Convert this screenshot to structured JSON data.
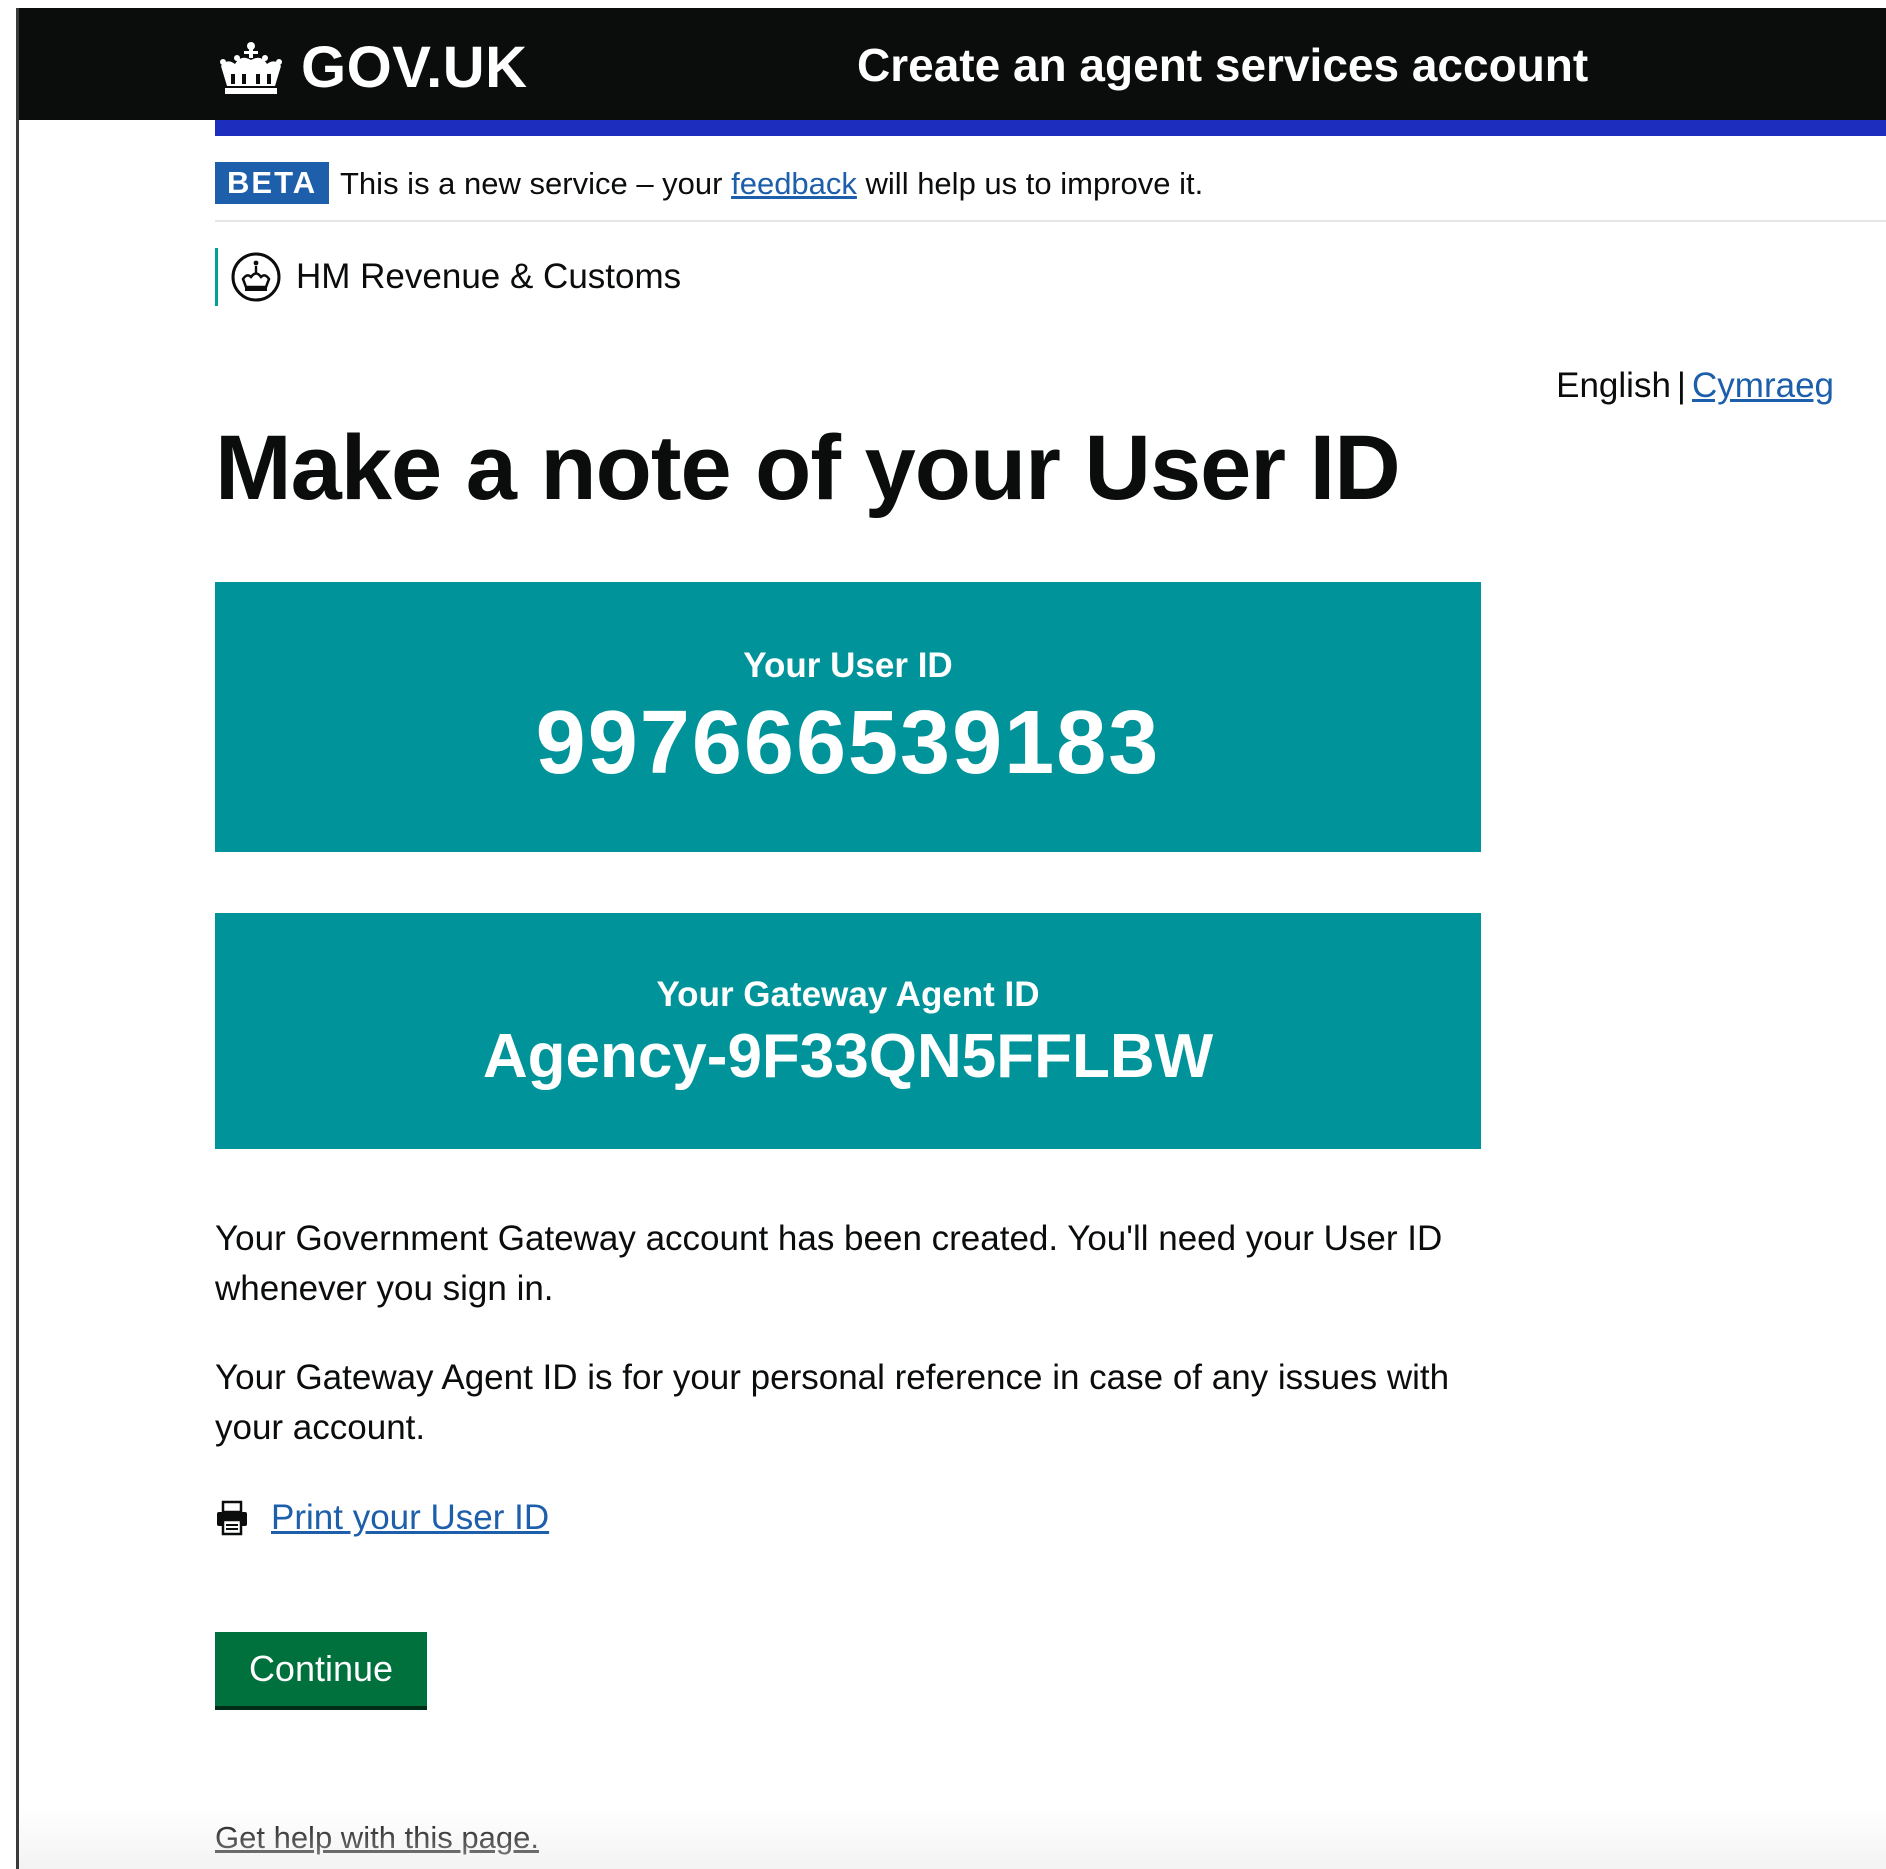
{
  "header": {
    "logo_text": "GOV.UK",
    "service_name": "Create an agent services account"
  },
  "phase_banner": {
    "tag": "BETA",
    "text_before": "This is a new service – your ",
    "link": "feedback",
    "text_after": " will help us to improve it."
  },
  "department": {
    "name": "HM Revenue & Customs"
  },
  "language": {
    "current": "English",
    "separator": "|",
    "alternate": "Cymraeg"
  },
  "main": {
    "title": "Make a note of your User ID",
    "user_id_panel": {
      "label": "Your User ID",
      "value": "997666539183"
    },
    "agent_id_panel": {
      "label": "Your Gateway Agent ID",
      "value": "Agency-9F33QN5FFLBW"
    },
    "paragraph_1": "Your Government Gateway account has been created. You'll need your User ID whenever you sign in.",
    "paragraph_2": "Your Gateway Agent ID is for your personal reference in case of any issues with your account.",
    "print_link": "Print your User ID",
    "continue_label": "Continue",
    "help_link": "Get help with this page."
  },
  "colors": {
    "header_bg": "#0b0c0c",
    "header_stripe": "#1d2dbd",
    "panel_bg": "#00949a",
    "link": "#1d5faa",
    "button_bg": "#00703c",
    "hmrc_accent": "#00a19b"
  },
  "icons": {
    "logo": "crown-icon",
    "department": "hmrc-crest-icon",
    "print": "printer-icon"
  }
}
